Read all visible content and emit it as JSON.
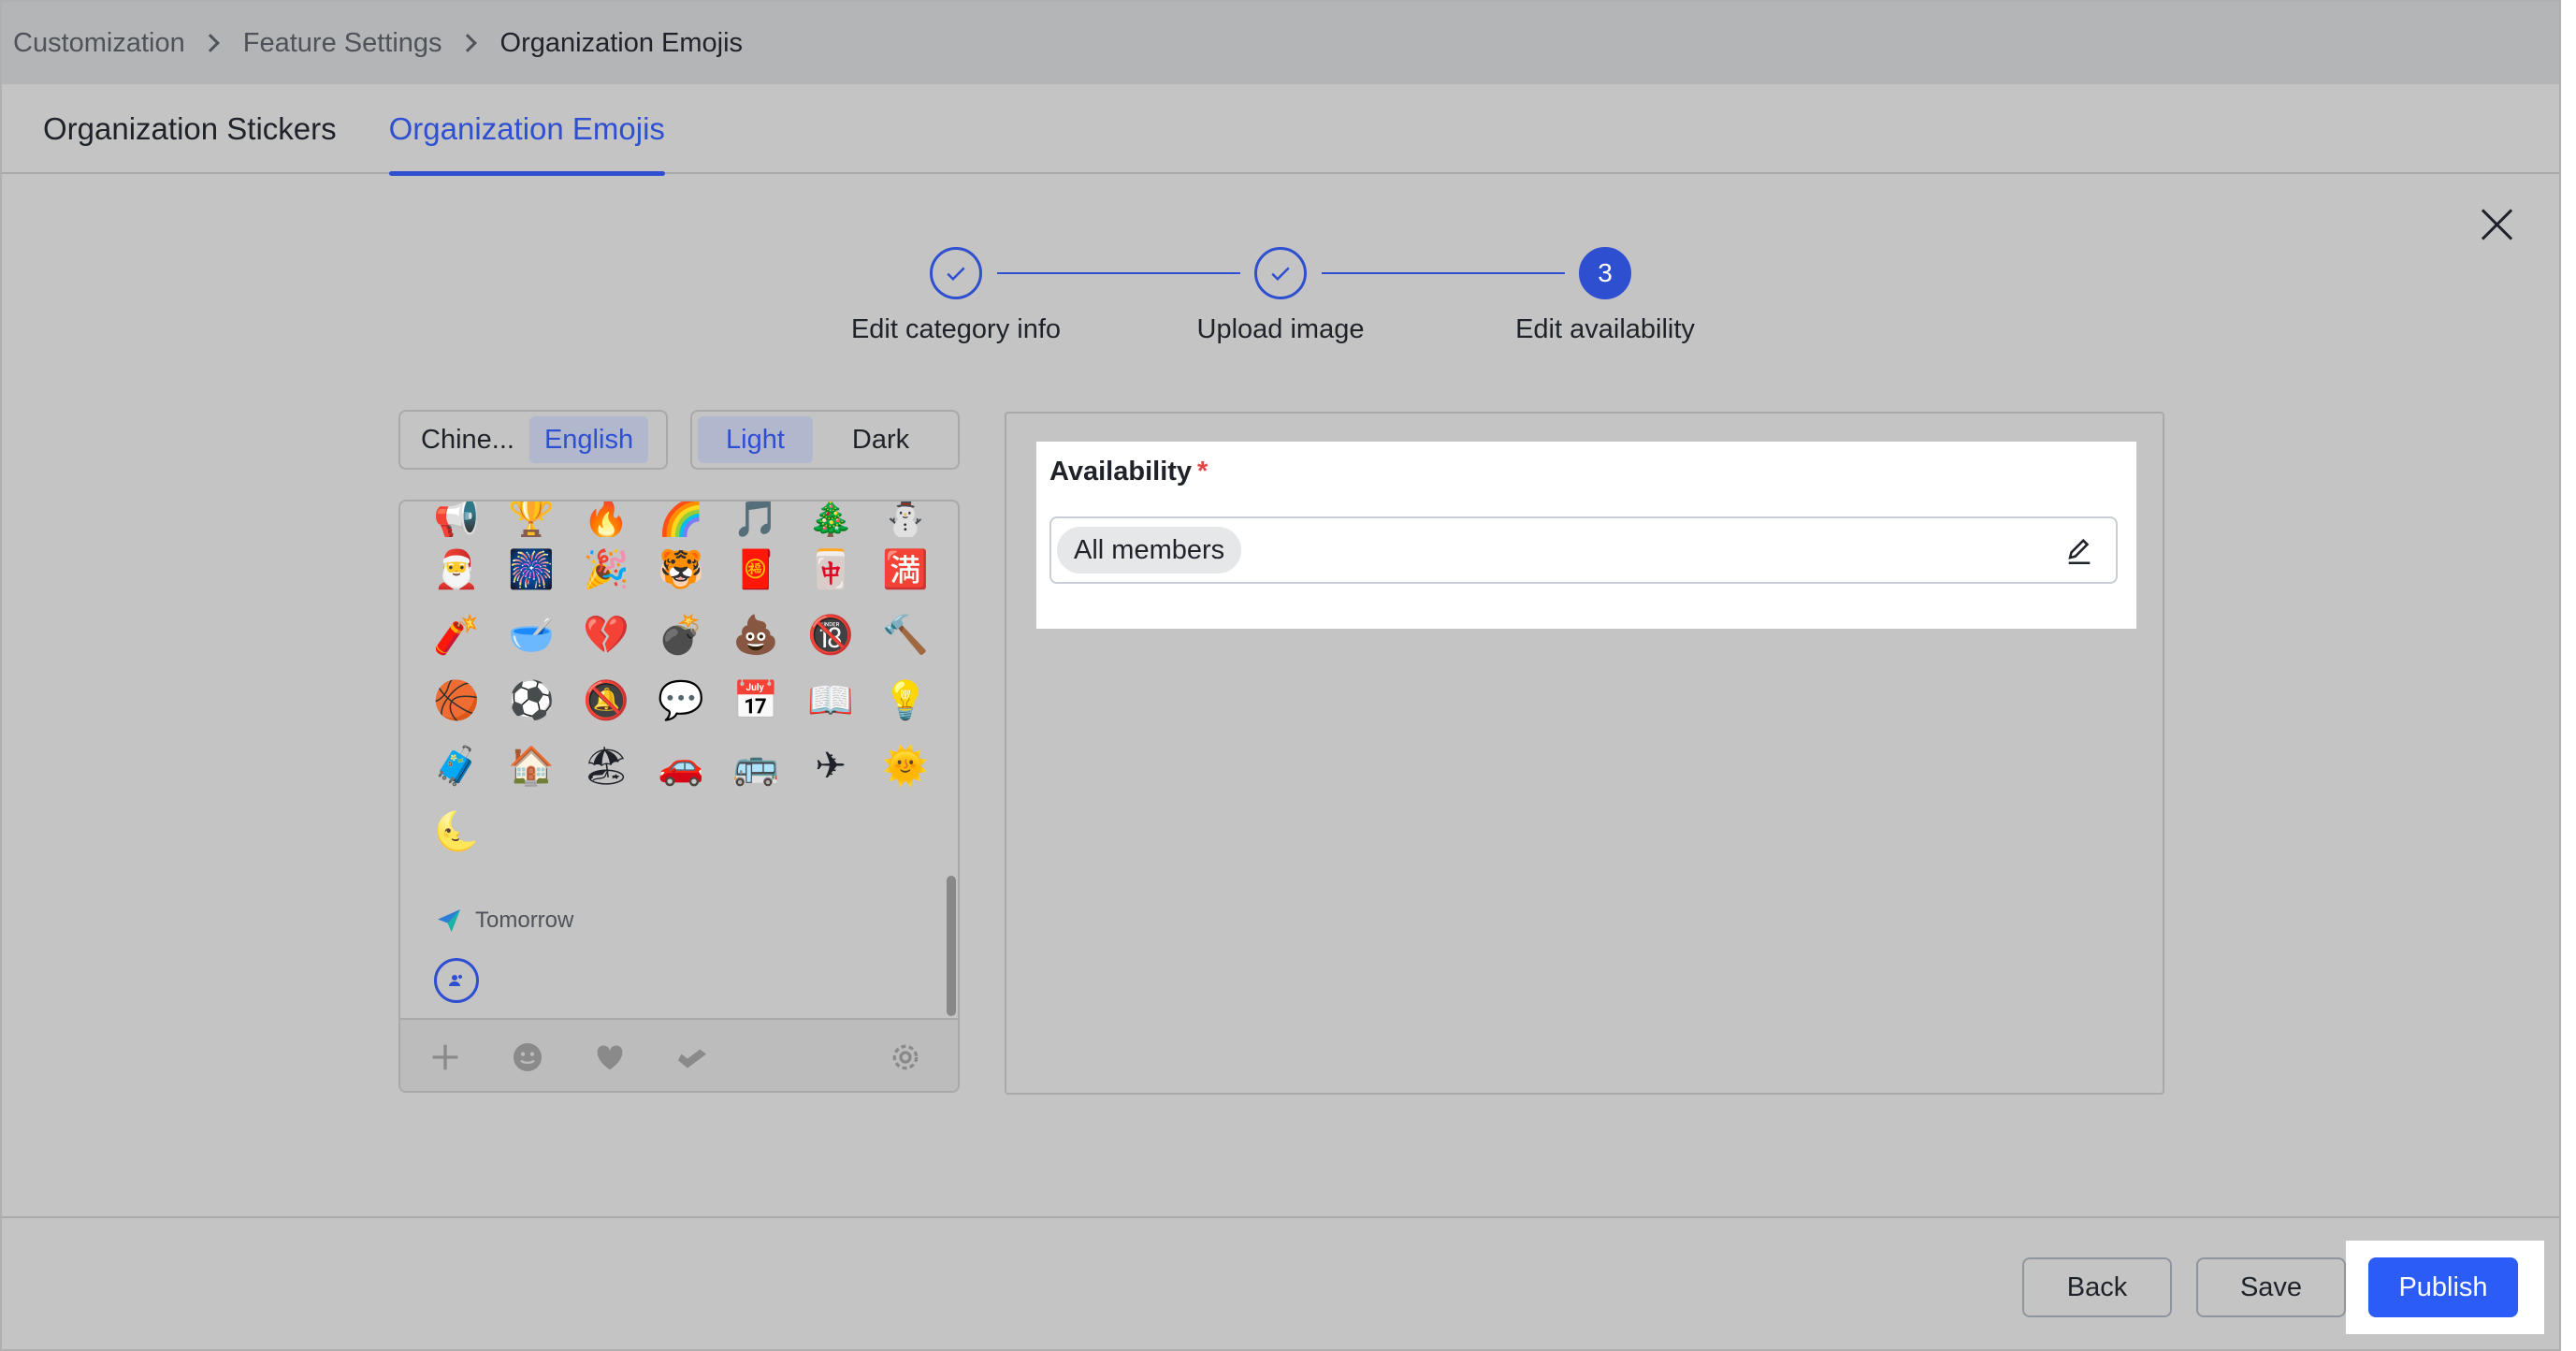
{
  "breadcrumb": {
    "items": [
      "Customization",
      "Feature Settings",
      "Organization Emojis"
    ]
  },
  "tabs": [
    {
      "label": "Organization Stickers",
      "active": false
    },
    {
      "label": "Organization Emojis",
      "active": true
    }
  ],
  "steps": [
    {
      "label": "Edit category info",
      "status": "done"
    },
    {
      "label": "Upload image",
      "status": "done"
    },
    {
      "label": "Edit availability",
      "status": "current",
      "number": "3"
    }
  ],
  "language_toggle": {
    "options": [
      "Chine...",
      "English"
    ],
    "selected": "English"
  },
  "theme_toggle": {
    "options": [
      "Light",
      "Dark"
    ],
    "selected": "Light"
  },
  "emoji_panel": {
    "rows": [
      [
        "📢",
        "🏆",
        "🔥",
        "🌈",
        "🎵",
        "🎄",
        "⛄"
      ],
      [
        "🎅",
        "🎆",
        "🎉",
        "🐯",
        "🧧",
        "🀄",
        "🈵"
      ],
      [
        "🧨",
        "🥣",
        "💔",
        "💣",
        "💩",
        "🔞",
        "🔨"
      ],
      [
        "🏀",
        "⚽",
        "🔕",
        "💬",
        "📅",
        "📖",
        "💡"
      ],
      [
        "🧳",
        "🏠",
        "🏖",
        "🚗",
        "🚌",
        "✈",
        "🌞"
      ],
      [
        "🌜"
      ]
    ],
    "tomorrow_label": "Tomorrow",
    "footer_icons": [
      "plus-icon",
      "smiley-icon",
      "heart-icon",
      "handshake-icon",
      "gear-icon"
    ]
  },
  "availability": {
    "title": "Availability",
    "required_mark": "*",
    "selected_tag": "All members"
  },
  "actions": {
    "back_label": "Back",
    "save_label": "Save",
    "publish_label": "Publish"
  },
  "colors": {
    "accent": "#2f4fd1",
    "primary_button": "#2b5cf5",
    "required": "#e54545"
  }
}
